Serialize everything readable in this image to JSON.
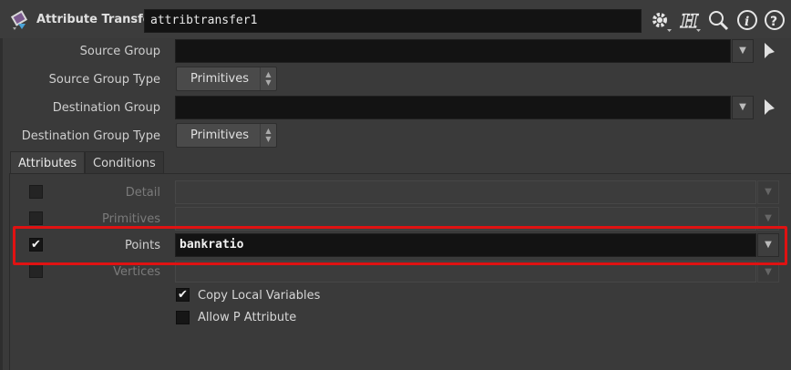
{
  "header": {
    "node_type": "Attribute Transfer",
    "node_name": "attribtransfer1",
    "icons": [
      "gear-icon",
      "houdini-help-icon",
      "search-icon",
      "info-icon",
      "help-icon"
    ]
  },
  "parms": {
    "source_group": {
      "label": "Source Group",
      "value": ""
    },
    "source_group_type": {
      "label": "Source Group Type",
      "value": "Primitives"
    },
    "destination_group": {
      "label": "Destination Group",
      "value": ""
    },
    "destination_group_type": {
      "label": "Destination Group Type",
      "value": "Primitives"
    }
  },
  "tabs": [
    {
      "label": "Attributes",
      "active": true
    },
    {
      "label": "Conditions",
      "active": false
    }
  ],
  "attributes": {
    "detail": {
      "label": "Detail",
      "checked": false,
      "value": ""
    },
    "primitives": {
      "label": "Primitives",
      "checked": false,
      "value": ""
    },
    "points": {
      "label": "Points",
      "checked": true,
      "value": "bankratio"
    },
    "vertices": {
      "label": "Vertices",
      "checked": false,
      "value": ""
    },
    "copy_local_variables": {
      "label": "Copy Local Variables",
      "checked": true
    },
    "allow_p_attribute": {
      "label": "Allow P Attribute",
      "checked": false
    }
  },
  "glyphs": {
    "check": "✔",
    "dropdown": "▼",
    "spin_up": "▲",
    "spin_down": "▼"
  },
  "colors": {
    "highlight": "#e01212",
    "field_bg": "#131313",
    "panel_bg": "#3a3a3a"
  }
}
